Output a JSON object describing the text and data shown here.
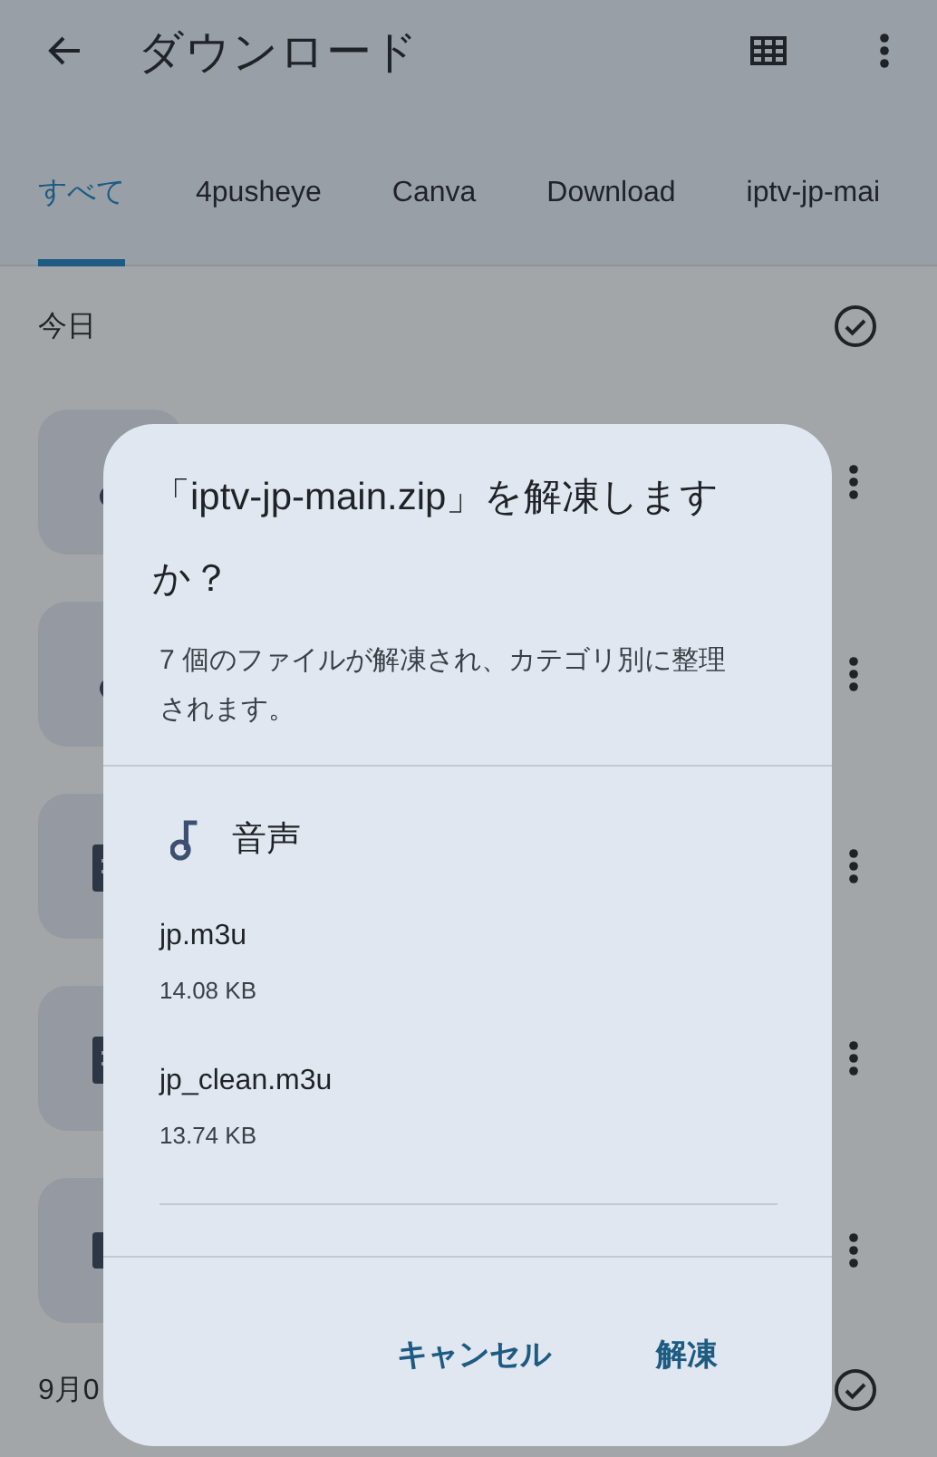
{
  "app_bar": {
    "title": "ダウンロード"
  },
  "tabs": [
    {
      "label": "すべて",
      "selected": true
    },
    {
      "label": "4pusheye",
      "selected": false
    },
    {
      "label": "Canva",
      "selected": false
    },
    {
      "label": "Download",
      "selected": false
    },
    {
      "label": "iptv-jp-mai",
      "selected": false
    }
  ],
  "sections": [
    {
      "header": "今日",
      "items": [
        {
          "kind": "audio"
        },
        {
          "kind": "audio"
        },
        {
          "kind": "document"
        },
        {
          "kind": "document"
        },
        {
          "kind": "folder"
        }
      ]
    },
    {
      "header": "9月0"
    }
  ],
  "dialog": {
    "title": "「iptv-jp-main.zip」を解凍しますか？",
    "message": "7 個のファイルが解凍され、カテゴリ別に整理されます。",
    "groups": [
      {
        "label": "音声",
        "files": [
          {
            "name": "jp.m3u",
            "size": "14.08 KB"
          },
          {
            "name": "jp_clean.m3u",
            "size": "13.74 KB"
          }
        ]
      }
    ],
    "buttons": [
      {
        "label": "キャンセル"
      },
      {
        "label": "解凍"
      }
    ]
  }
}
